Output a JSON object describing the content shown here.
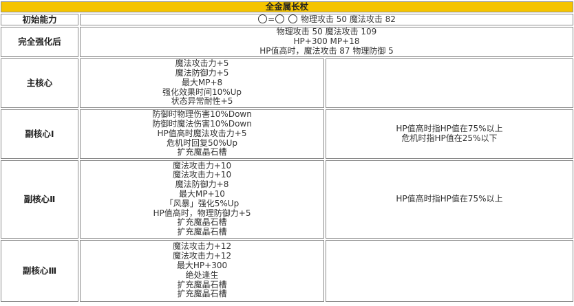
{
  "title": "全金属长杖",
  "initial": {
    "label": "初始能力",
    "slots_text": "=",
    "stats": "物理攻击 50 魔法攻击 82"
  },
  "full_enhance": {
    "label": "完全强化后",
    "lines": [
      "物理攻击 50 魔法攻击 109",
      "HP+300 MP+18",
      "HP值高时，魔法攻击 87 物理防御 5"
    ]
  },
  "main_core": {
    "label": "主核心",
    "lines": [
      "魔法攻击力+5",
      "魔法防御力+5",
      "最大MP+8",
      "强化效果时间10%Up",
      "状态异常耐性+5"
    ],
    "note": ""
  },
  "sub_core_1": {
    "label": "副核心Ⅰ",
    "lines": [
      "防御时物理伤害10%Down",
      "防御时魔法伤害10%Down",
      "HP值高时魔法攻击力+5",
      "危机时回复50%Up",
      "扩充魔晶石槽"
    ],
    "notes": [
      "HP值高时指HP值在75%以上",
      "危机时指HP值在25%以下"
    ]
  },
  "sub_core_2": {
    "label": "副核心Ⅱ",
    "lines": [
      "魔法攻击力+10",
      "魔法攻击力+10",
      "魔法防御力+8",
      "最大MP+10",
      "「风暴」强化5%Up",
      "HP值高时，物理防御力+5",
      "扩充魔晶石槽",
      "扩充魔晶石槽"
    ],
    "notes": [
      "HP值高时指HP值在75%以上"
    ]
  },
  "sub_core_3": {
    "label": "副核心Ⅲ",
    "lines": [
      "魔法攻击力+12",
      "魔法攻击力+12",
      "最大HP+300",
      "绝处逢生",
      "扩充魔晶石槽",
      "扩充魔晶石槽"
    ],
    "notes": []
  }
}
